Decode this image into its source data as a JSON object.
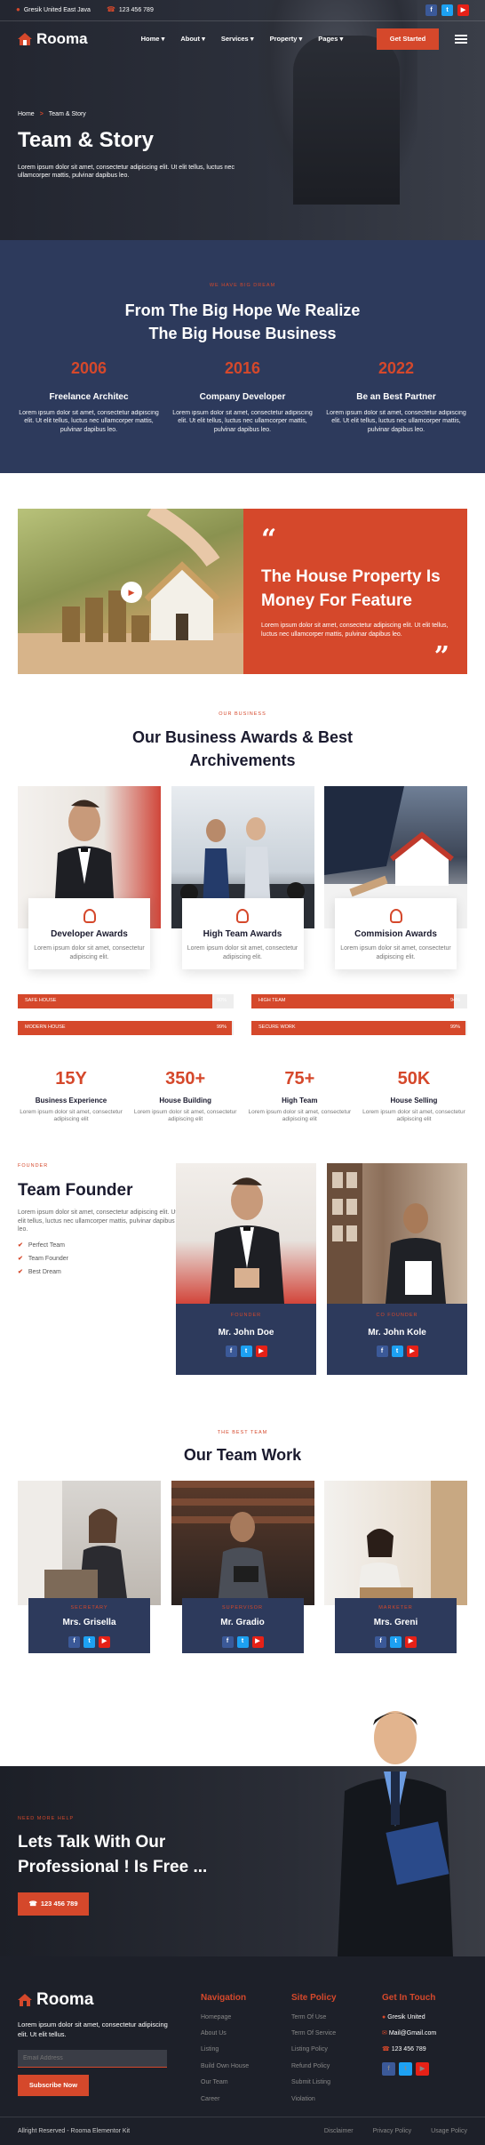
{
  "topbar": {
    "address": "Gresik United East Java",
    "phone": "123 456 789"
  },
  "brand": {
    "name": "Rooma"
  },
  "nav": {
    "items": [
      "Home",
      "About",
      "Services",
      "Property",
      "Pages"
    ],
    "cta": "Get Started"
  },
  "hero": {
    "breadcrumb_home": "Home",
    "breadcrumb_sep": ">",
    "breadcrumb_current": "Team & Story",
    "title": "Team & Story",
    "text": "Lorem ipsum dolor sit amet, consectetur adipiscing elit. Ut elit tellus, luctus nec ullamcorper mattis, pulvinar dapibus leo."
  },
  "story": {
    "eyebrow": "WE HAVE BIG DREAM",
    "title1": "From The Big Hope We Realize",
    "title2": "The Big House Business",
    "items": [
      {
        "year": "2006",
        "title": "Freelance Architec",
        "text": "Lorem ipsum dolor sit amet, consectetur adipiscing elit. Ut elit tellus, luctus nec ullamcorper mattis, pulvinar dapibus leo."
      },
      {
        "year": "2016",
        "title": "Company Developer",
        "text": "Lorem ipsum dolor sit amet, consectetur adipiscing elit. Ut elit tellus, luctus nec ullamcorper mattis, pulvinar dapibus leo."
      },
      {
        "year": "2022",
        "title": "Be an Best Partner",
        "text": "Lorem ipsum dolor sit amet, consectetur adipiscing elit. Ut elit tellus, luctus nec ullamcorper mattis, pulvinar dapibus leo."
      }
    ]
  },
  "promo": {
    "quote_open": "“",
    "quote_close": "”",
    "title": "The House Property Is Money For Feature",
    "text": "Lorem ipsum dolor sit amet, consectetur adipiscing elit. Ut elit tellus, luctus nec ullamcorper mattis, pulvinar dapibus leo."
  },
  "awards": {
    "eyebrow": "OUR BUSINESS",
    "title1": "Our Business Awards & Best",
    "title2": "Archivements",
    "cards": [
      {
        "title": "Developer Awards",
        "text": "Lorem ipsum dolor sit amet, consectetur adipiscing elit."
      },
      {
        "title": "High Team Awards",
        "text": "Lorem ipsum dolor sit amet, consectetur adipiscing elit."
      },
      {
        "title": "Commision Awards",
        "text": "Lorem ipsum dolor sit amet, consectetur adipiscing elit."
      }
    ],
    "bars": [
      {
        "label": "SAFE HOUSE",
        "value": "90%",
        "fraction": 0.9
      },
      {
        "label": "HIGH TEAM",
        "value": "94%",
        "fraction": 0.94
      },
      {
        "label": "MODERN HOUSE",
        "value": "99%",
        "fraction": 0.99
      },
      {
        "label": "SECURE WORK",
        "value": "99%",
        "fraction": 0.99
      }
    ],
    "counters": [
      {
        "num": "15Y",
        "label": "Business Experience",
        "text": "Lorem ipsum dolor sit amet, consectetur adipiscing elit"
      },
      {
        "num": "350+",
        "label": "House Building",
        "text": "Lorem ipsum dolor sit amet, consectetur adipiscing elit"
      },
      {
        "num": "75+",
        "label": "High Team",
        "text": "Lorem ipsum dolor sit amet, consectetur adipiscing elit"
      },
      {
        "num": "50K",
        "label": "House Selling",
        "text": "Lorem ipsum dolor sit amet, consectetur adipiscing elit"
      }
    ]
  },
  "founder": {
    "eyebrow": "FOUNDER",
    "title": "Team Founder",
    "text": "Lorem ipsum dolor sit amet, consectetur adipiscing elit. Ut elit tellus, luctus nec ullamcorper mattis, pulvinar dapibus leo.",
    "checks": [
      "Perfect Team",
      "Team Founder",
      "Best Dream"
    ],
    "people": [
      {
        "role": "FOUNDER",
        "name": "Mr. John Doe"
      },
      {
        "role": "CO FOUNDER",
        "name": "Mr. John Kole"
      }
    ]
  },
  "team": {
    "eyebrow": "THE BEST TEAM",
    "title": "Our Team Work",
    "people": [
      {
        "role": "SECRETARY",
        "name": "Mrs. Grisella"
      },
      {
        "role": "SUPERVISOR",
        "name": "Mr. Gradio"
      },
      {
        "role": "MARKETER",
        "name": "Mrs. Greni"
      }
    ]
  },
  "cta": {
    "eyebrow": "NEED MORE HELP",
    "title1": "Lets Talk With Our",
    "title2": "Professional ! Is Free ...",
    "phone": "123 456 789"
  },
  "footer": {
    "about": "Lorem ipsum dolor sit amet, consectetur adipiscing elit. Ut elit tellus.",
    "email_placeholder": "Email Address",
    "subscribe": "Subscribe Now",
    "nav_title": "Navigation",
    "nav_items": [
      "Homepage",
      "About Us",
      "Listing",
      "Build Own House",
      "Our Team",
      "Career"
    ],
    "policy_title": "Site Policy",
    "policy_items": [
      "Term Of Use",
      "Term Of Service",
      "Listing Policy",
      "Refund Policy",
      "Submit Listing",
      "Violation"
    ],
    "touch_title": "Get In Touch",
    "touch_items": [
      "Gresik United",
      "Mail@Gmail.com",
      "123 456 789"
    ],
    "copyright": "Allright Reserved - Rooma Elementor Kit",
    "bottom_links": [
      "Disclaimer",
      "Privacy Policy",
      "Usage Policy"
    ]
  },
  "colors": {
    "accent": "#d5482b",
    "navy": "#2d3a5c",
    "dark": "#1d2029"
  },
  "icons": [
    "map-pin-icon",
    "phone-icon",
    "facebook-icon",
    "twitter-icon",
    "youtube-icon",
    "house-logo-icon",
    "chevron-down-icon",
    "menu-icon",
    "play-icon",
    "quote-icon",
    "award-icon",
    "check-icon",
    "mail-icon"
  ]
}
